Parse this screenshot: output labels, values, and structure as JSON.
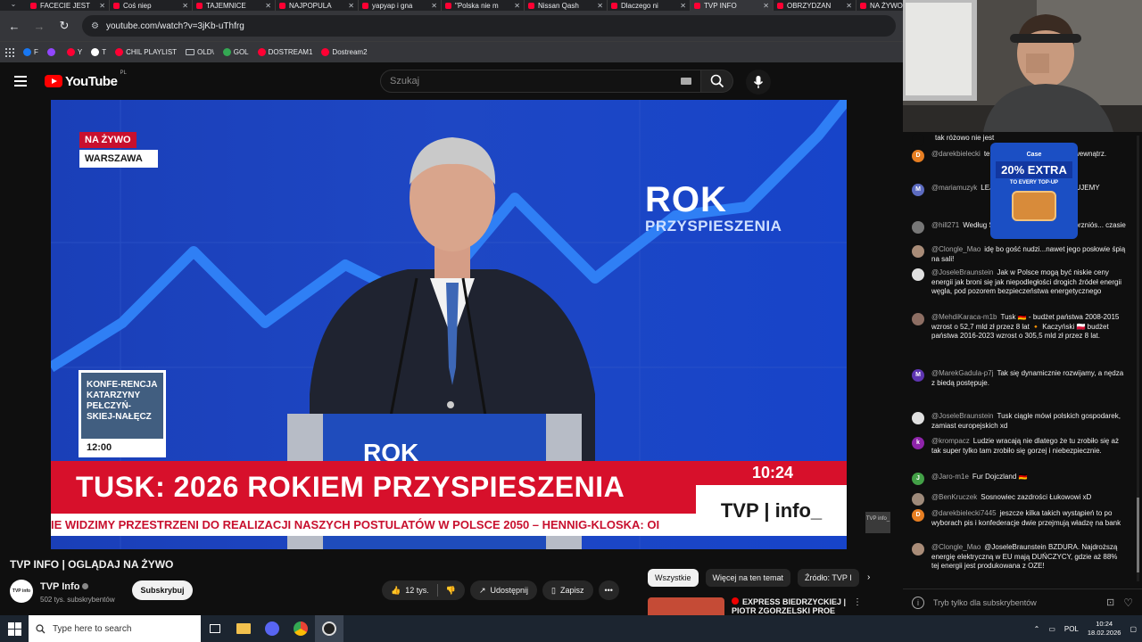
{
  "browser": {
    "tabs": [
      {
        "title": "FACECIE JEST",
        "active": false
      },
      {
        "title": "Coś niep",
        "active": false
      },
      {
        "title": "TAJEMNICE",
        "active": false
      },
      {
        "title": "NAJPOPULA",
        "active": false
      },
      {
        "title": "yapyap i gna",
        "active": false
      },
      {
        "title": "\"Polska nie m",
        "active": false
      },
      {
        "title": "Nissan Qash",
        "active": false
      },
      {
        "title": "Dlaczego ni",
        "active": false
      },
      {
        "title": "TVP INFO",
        "active": true
      },
      {
        "title": "OBRZYDZAN",
        "active": false
      },
      {
        "title": "NA ŻYWO",
        "active": false
      }
    ],
    "url": "youtube.com/watch?v=3jKb-uThfrg",
    "bookmarks": [
      {
        "label": "F",
        "icon": "facebook-icon",
        "color": "#1877f2"
      },
      {
        "label": "",
        "icon": "twitch-icon",
        "color": "#9146ff"
      },
      {
        "label": "Y",
        "icon": "youtube-icon",
        "color": "#ff0033"
      },
      {
        "label": "T",
        "icon": "x-icon",
        "color": "#ffffff"
      },
      {
        "label": "CHIL PLAYLIST",
        "icon": "youtube-icon",
        "color": "#ff0033"
      },
      {
        "label": "OLD\\",
        "icon": "folder-icon",
        "color": ""
      },
      {
        "label": "GOL",
        "icon": "gol-icon",
        "color": "#34a853"
      },
      {
        "label": "DOSTREAM1",
        "icon": "youtube-icon",
        "color": "#ff0033"
      },
      {
        "label": "Dostream2",
        "icon": "youtube-icon",
        "color": "#ff0033"
      }
    ]
  },
  "youtube": {
    "logo": "YouTube",
    "region": "PL",
    "search_placeholder": "Szukaj"
  },
  "video": {
    "live_label": "NA ŻYWO",
    "location": "WARSZAWA",
    "backdrop_logo_main": "ROK",
    "backdrop_logo_sub": "PRZYSPIESZENIA",
    "podium_logo": "ROK",
    "conference_text": "KONFE-RENCJA KATARZYNY PEŁCZYŃ-SKIEJ-NAŁĘCZ",
    "conference_time": "12:00",
    "headline": "TUSK: 2026 ROKIEM PRZYSPIESZENIA",
    "clock": "10:24",
    "ticker": "IE WIDZIMY PRZESTRZENI DO REALIZACJI NASZYCH POSTULATÓW W POLSCE 2050 – HENNIG-KLOSKA: OI",
    "channel_logo": "TVP | info_",
    "corner_logo": "TVP info_"
  },
  "meta": {
    "title": "TVP INFO | OGLĄDAJ NA ŻYWO",
    "channel_name": "TVP Info",
    "avatar_text": "TVP info",
    "subscribers": "502 tys. subskrybentów",
    "subscribe_label": "Subskrybuj",
    "likes": "12 tys.",
    "share_label": "Udostępnij",
    "save_label": "Zapisz",
    "chips": [
      "Wszystkie",
      "Więcej na ten temat",
      "Źródło: TVP I"
    ],
    "rec_title_line1": "EXPRESS BIEDRZYCKIEJ |",
    "rec_title_line2": "PIOTR ZGORZELSKI PROE"
  },
  "chat": {
    "messages": [
      {
        "author": "",
        "text": "tak różowo nie jest",
        "avatar_letter": "",
        "avatar_color": "#0f0f0f"
      },
      {
        "author": "@darekbielecki",
        "text": "te same błędy, zbyt mał... m wewnątrz.",
        "avatar_letter": "D",
        "avatar_color": "#e67e22"
      },
      {
        "author": "@mariamuzyk",
        "text": "LEJ POLSKA DUMN... DZIĘKUJEMY",
        "avatar_letter": "M",
        "avatar_color": "#5c6bc0"
      },
      {
        "author": "@hill271",
        "text": "Według Św... Łuków ekonomicznie przniós... czasie",
        "avatar_letter": "",
        "avatar_color": "#777777"
      },
      {
        "author": "@Clongle_Mao",
        "text": "idę bo gość nudzi...nawet jego posłowie śpią na sali!",
        "avatar_letter": "",
        "avatar_color": "#a98c78"
      },
      {
        "author": "@JoseleBraunstein",
        "text": "Jak w Polsce mogą być niskie ceny energii jak broni się jak niepodległości drogich źródeł energii węgla, pod pozorem bezpieczeństwa energetycznego",
        "avatar_letter": "",
        "avatar_color": "#e0e0e0"
      },
      {
        "author": "@MehdiKaraca-m1b",
        "text": "Tusk 🇩🇪 - budżet państwa 2008-2015 wzrost o 52,7 mld zł przez 8 lat 🔸 Kaczyński 🇵🇱 budżet państwa 2016-2023 wzrost o 305,5 mld zł przez 8 lat.",
        "avatar_letter": "",
        "avatar_color": "#8d6e63"
      },
      {
        "author": "@MarekGadula-p7j",
        "text": "Tak się dynamicznie rozwijamy, a nędza z biedą postępuje.",
        "avatar_letter": "M",
        "avatar_color": "#5e35b1"
      },
      {
        "author": "@JoseleBraunstein",
        "text": "Tusk ciągle mówi polskich gospodarek, zamiast europejskich xd",
        "avatar_letter": "",
        "avatar_color": "#e0e0e0"
      },
      {
        "author": "@krompacz",
        "text": "Ludzie wracają nie dlatego że tu zrobiło się aż tak super tylko tam zrobiło się gorzej i niebezpiecznie.",
        "avatar_letter": "k",
        "avatar_color": "#8e24aa"
      },
      {
        "author": "@Jaro-m1e",
        "text": "Fur Dojczland 🇩🇪",
        "avatar_letter": "J",
        "avatar_color": "#43a047"
      },
      {
        "author": "@BenKruczek",
        "text": "Sosnowiec zazdrości Łukowowi xD",
        "avatar_letter": "",
        "avatar_color": "#9e8a7a"
      },
      {
        "author": "@darekbielecki7445",
        "text": "jeszcze kilka takich wystąpień to po wyborach pis i konfederacje dwie przejmują władzę na bank",
        "avatar_letter": "D",
        "avatar_color": "#e67e22"
      },
      {
        "author": "@Clongle_Mao",
        "text": "@JoseleBraunstein BZDURA. Najdroższą energię elektryczną w EU mają DUŃCZYCY, gdzie aż 88% tej energii jest produkowana z OZE!",
        "avatar_letter": "",
        "avatar_color": "#a98c78"
      }
    ],
    "input_placeholder": "Tryb tylko dla subskrybentów"
  },
  "ad": {
    "brand": "Case",
    "headline": "20% EXTRA",
    "sub": "TO EVERY TOP-UP"
  },
  "taskbar": {
    "search_placeholder": "Type here to search",
    "language": "POL",
    "time": "10:24",
    "date": "18.02.2026"
  }
}
